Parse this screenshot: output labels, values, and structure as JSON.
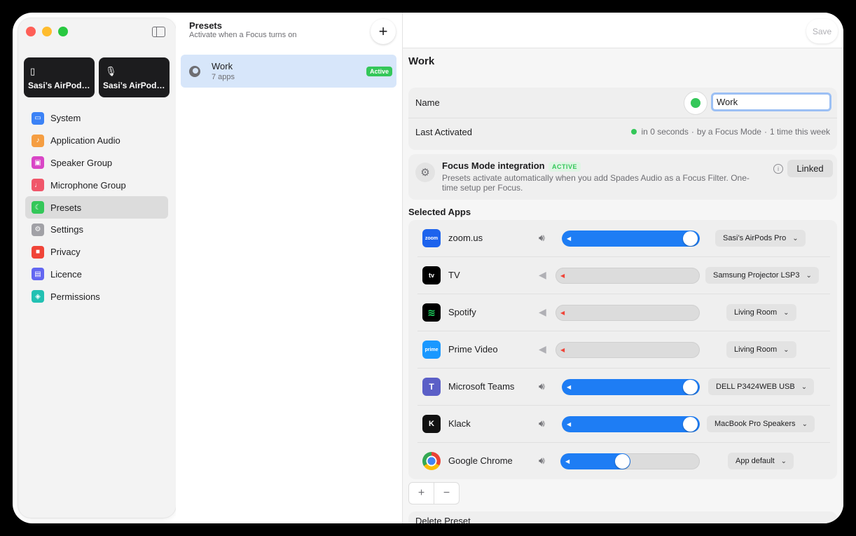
{
  "sidebar": {
    "devices": [
      {
        "label": "Sasi’s AirPods...",
        "icon": "speaker-icon"
      },
      {
        "label": "Sasi’s AirPods...",
        "icon": "microphone-icon"
      }
    ],
    "items": [
      {
        "label": "System",
        "icon": "laptop-icon",
        "color": "#3b82f6"
      },
      {
        "label": "Application Audio",
        "icon": "music-note-icon",
        "color": "#f59e42"
      },
      {
        "label": "Speaker Group",
        "icon": "speaker-group-icon",
        "color": "#d946c6"
      },
      {
        "label": "Microphone Group",
        "icon": "microphone-icon",
        "color": "#f0566a"
      },
      {
        "label": "Presets",
        "icon": "moon-icon",
        "color": "#34c759"
      },
      {
        "label": "Settings",
        "icon": "gear-icon",
        "color": "#a1a1a6"
      },
      {
        "label": "Privacy",
        "icon": "lock-icon",
        "color": "#f04438"
      },
      {
        "label": "Licence",
        "icon": "document-icon",
        "color": "#6366f1"
      },
      {
        "label": "Permissions",
        "icon": "shield-icon",
        "color": "#22c1b3"
      }
    ],
    "selected": "Presets"
  },
  "presets": {
    "title": "Presets",
    "subtitle": "Activate when a Focus turns on",
    "add_label": "+",
    "items": [
      {
        "name": "Work",
        "count": "7 apps",
        "badge": "Active"
      }
    ]
  },
  "detail": {
    "save_label": "Save",
    "title": "Work",
    "name_label": "Name",
    "name_value": "Work",
    "last_activated_label": "Last Activated",
    "last_activated_when": "in 0 seconds",
    "last_activated_by": "by a Focus Mode",
    "last_activated_freq": "1 time this week",
    "focus": {
      "title": "Focus Mode integration",
      "badge": "ACTIVE",
      "desc": "Presets activate automatically when you add Spades Audio as a Focus Filter. One-time setup per Focus.",
      "button": "Linked"
    },
    "selected_apps_label": "Selected Apps",
    "apps": [
      {
        "name": "zoom.us",
        "volume": 1.0,
        "muted": false,
        "output": "Sasi’s AirPods Pro",
        "icon_color": "#1d63ed",
        "icon_text": "zoom"
      },
      {
        "name": "TV",
        "volume": 0.0,
        "muted": true,
        "output": "Samsung Projector LSP3",
        "icon_color": "#000000",
        "icon_text": "tv"
      },
      {
        "name": "Spotify",
        "volume": 0.0,
        "muted": true,
        "output": "Living Room",
        "icon_color": "#000000",
        "icon_text": "≋"
      },
      {
        "name": "Prime Video",
        "volume": 0.0,
        "muted": true,
        "output": "Living Room",
        "icon_color": "#1a98ff",
        "icon_text": "prime"
      },
      {
        "name": "Microsoft Teams",
        "volume": 1.0,
        "muted": false,
        "output": "DELL P3424WEB USB",
        "icon_color": "#5b5fc7",
        "icon_text": "T"
      },
      {
        "name": "Klack",
        "volume": 1.0,
        "muted": false,
        "output": "MacBook Pro Speakers",
        "icon_color": "#111111",
        "icon_text": "K"
      },
      {
        "name": "Google Chrome",
        "volume": 0.45,
        "muted": false,
        "output": "App default",
        "icon_color": "#ffffff",
        "icon_text": "●"
      }
    ],
    "add_app": "+",
    "remove_app": "−",
    "delete_label": "Delete Preset"
  }
}
